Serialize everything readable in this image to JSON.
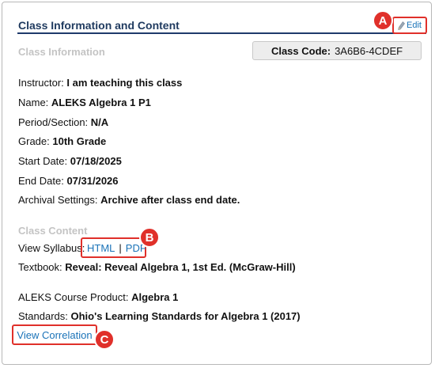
{
  "header": {
    "title": "Class Information and Content",
    "edit_label": "Edit"
  },
  "callouts": {
    "a": "A",
    "b": "B",
    "c": "C"
  },
  "class_info": {
    "section_label": "Class Information",
    "class_code_label": "Class Code:",
    "class_code_value": "3A6B6-4CDEF",
    "fields": [
      {
        "label": "Instructor:",
        "value": "I am teaching this class"
      },
      {
        "label": "Name:",
        "value": "ALEKS Algebra 1 P1"
      },
      {
        "label": "Period/Section:",
        "value": "N/A"
      },
      {
        "label": "Grade:",
        "value": "10th Grade"
      },
      {
        "label": "Start Date:",
        "value": "07/18/2025"
      },
      {
        "label": "End Date:",
        "value": "07/31/2026"
      },
      {
        "label": "Archival Settings:",
        "value": "Archive after class end date."
      }
    ]
  },
  "class_content": {
    "section_label": "Class Content",
    "syllabus_label": "View Syllabus:",
    "syllabus_html": "HTML",
    "syllabus_separator": "|",
    "syllabus_pdf": "PDF",
    "textbook_label": "Textbook:",
    "textbook_value": "Reveal: Reveal Algebra 1, 1st Ed. (McGraw-Hill)",
    "product_label": "ALEKS Course Product:",
    "product_value": "Algebra 1",
    "standards_label": "Standards:",
    "standards_value": "Ohio's Learning Standards for Algebra 1 (2017)",
    "correlation_link": "View Correlation"
  },
  "colors": {
    "accent_red": "#e0302a",
    "link_blue": "#1a73b8",
    "header_navy": "#1f3a5f",
    "section_gray": "#c4c4c4"
  },
  "icons": {
    "edit": "pencil-icon"
  }
}
